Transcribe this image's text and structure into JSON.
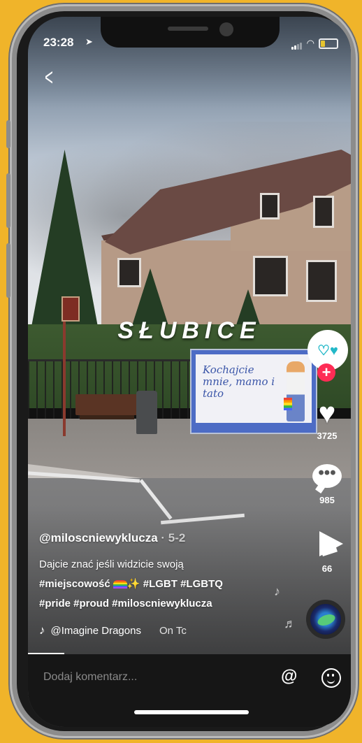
{
  "status_bar": {
    "time": "23:28",
    "location_arrow": "location-arrow-icon"
  },
  "video": {
    "overlay_title": "SŁUBICE",
    "billboard_text": "Kochajcie mnie, mamo i tato"
  },
  "actions": {
    "likes": "3725",
    "comments": "985",
    "shares": "66",
    "comment_glyph": "•••"
  },
  "post": {
    "username": "@miloscniewyklucza",
    "date": "5-2",
    "caption_line1": "Dajcie znać jeśli widzicie swoją",
    "caption_line2_start": "#miejscowość",
    "caption_line2_tags": "#LGBT #LGBTQ",
    "caption_line3": "#pride #proud #miloscniewyklucza",
    "music": "@Imagine Dragons",
    "music_song": "On Tc"
  },
  "comment_bar": {
    "placeholder": "Dodaj komentarz..."
  },
  "colors": {
    "background": "#f0b42a",
    "follow": "#fe2c55"
  }
}
